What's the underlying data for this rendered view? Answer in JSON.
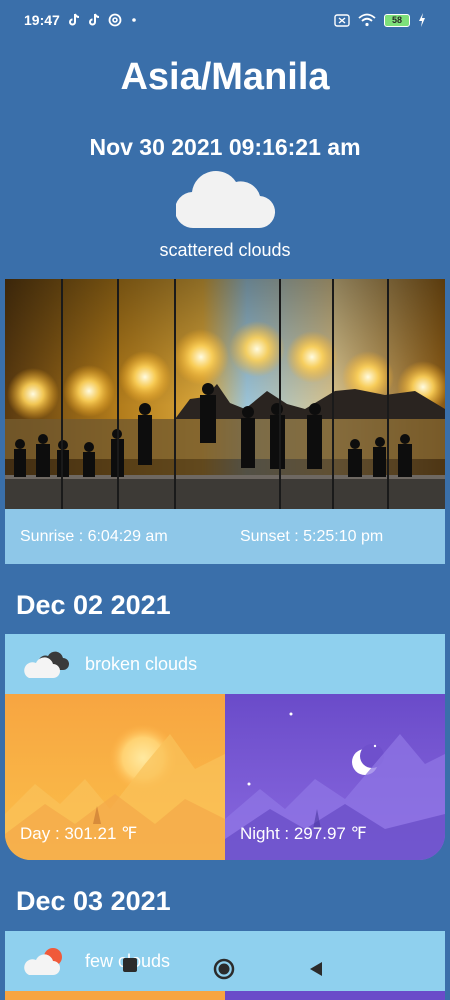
{
  "status_bar": {
    "time": "19:47",
    "battery": "58",
    "icons": [
      "tiktok-icon",
      "tiktok-icon",
      "at-sign-icon",
      "dot-icon",
      "sim-off-icon",
      "wifi-icon",
      "battery-icon",
      "charging-icon"
    ]
  },
  "location": "Asia/Manila",
  "datetime": "Nov 30 2021 09:16:21 am",
  "current": {
    "description": "scattered clouds",
    "icon": "cloud-icon"
  },
  "sun": {
    "sunrise": "Sunrise : 6:04:29 am",
    "sunset": "Sunset : 5:25:10 pm"
  },
  "forecast": [
    {
      "date": "Dec 02 2021",
      "condition": "broken clouds",
      "icon": "broken-clouds-icon",
      "day": "Day : 301.21 ℉",
      "night": "Night : 297.97 ℉"
    },
    {
      "date": "Dec 03 2021",
      "condition": "few clouds",
      "icon": "few-clouds-icon"
    }
  ],
  "colors": {
    "background": "#3a6faa",
    "card": "#8ec7e8",
    "condition_bar": "#8fd0ee",
    "day_panel": "#f5a84a",
    "night_panel": "#7b5cd6"
  },
  "nav": [
    "recents-button",
    "home-button",
    "back-button"
  ]
}
